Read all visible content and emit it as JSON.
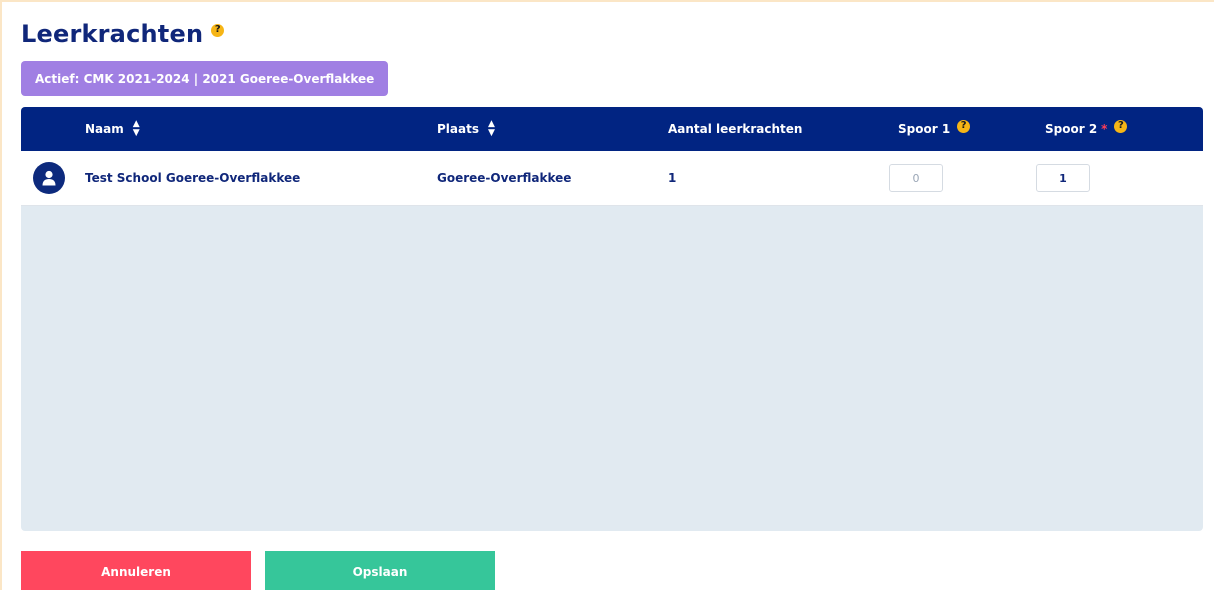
{
  "page": {
    "title": "Leerkrachten",
    "title_help_icon": "question-icon",
    "active_label": "Actief: CMK 2021-2024 | 2021 Goeree-Overflakkee"
  },
  "table": {
    "headers": {
      "naam": "Naam",
      "plaats": "Plaats",
      "aantal": "Aantal leerkrachten",
      "spoor1": "Spoor 1",
      "spoor2": "Spoor 2",
      "required_marker": "*",
      "sort_icon": "sort-icon",
      "help_icon": "question-icon"
    },
    "rows": [
      {
        "avatar_icon": "user-icon",
        "naam": "Test School Goeree-Overflakkee",
        "plaats": "Goeree-Overflakkee",
        "aantal": "1",
        "spoor1": "0",
        "spoor2": "1"
      }
    ]
  },
  "actions": {
    "cancel_label": "Annuleren",
    "save_label": "Opslaan"
  },
  "colors": {
    "brand_navy": "#012482",
    "title_navy": "#10277a",
    "badge_purple": "#a07fe3",
    "help_yellow": "#f6b516",
    "cancel_red": "#ff475e",
    "save_green": "#36c69a",
    "table_empty_bg": "#e1eaf1"
  }
}
